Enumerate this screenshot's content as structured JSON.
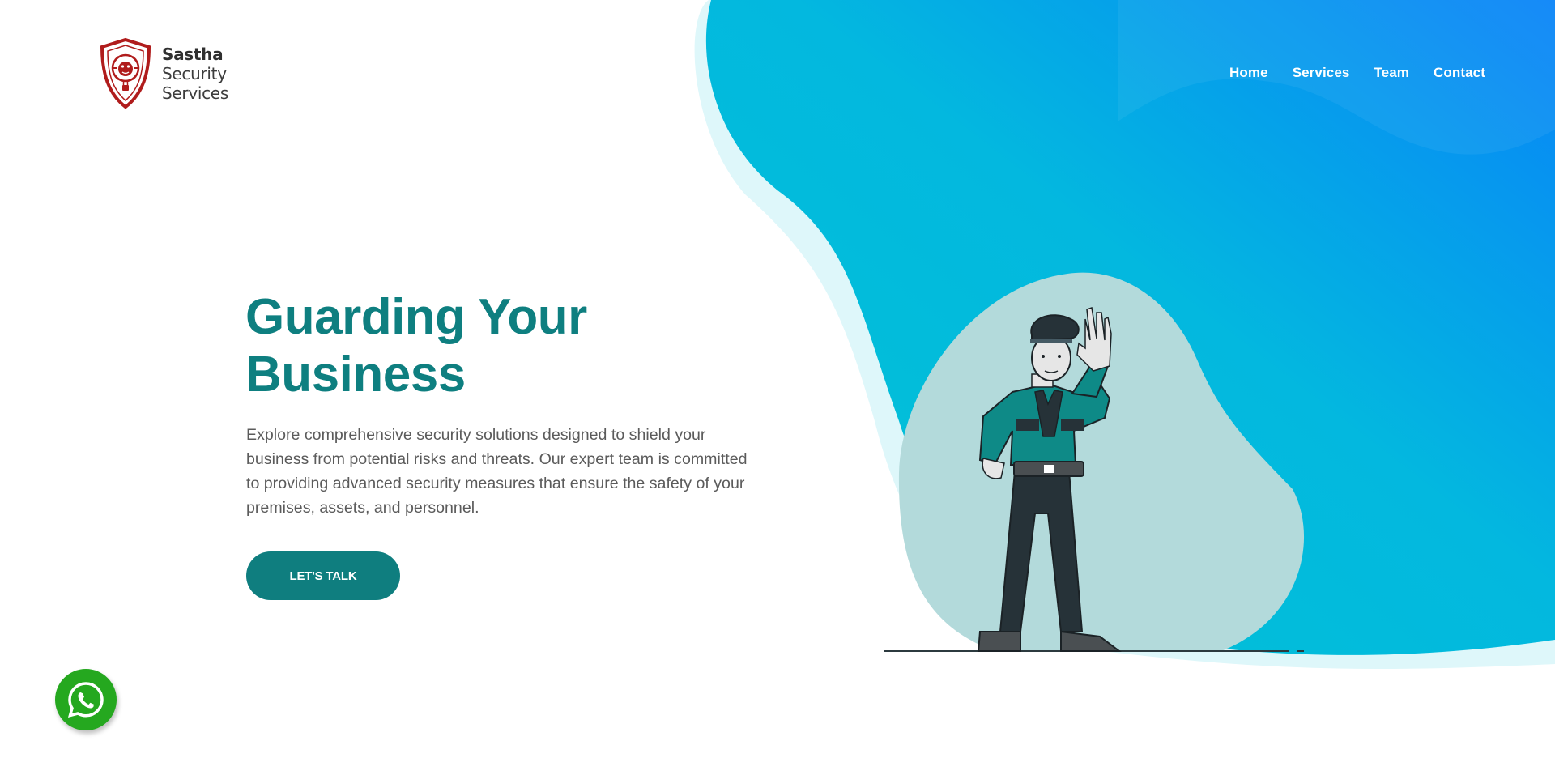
{
  "brand": {
    "name_line1": "Sastha",
    "name_line2": "Security",
    "name_line3": "Services",
    "logo_icon": "lion-shield-icon"
  },
  "nav": {
    "items": [
      {
        "label": "Home"
      },
      {
        "label": "Services"
      },
      {
        "label": "Team"
      },
      {
        "label": "Contact"
      }
    ]
  },
  "hero": {
    "title_line1": "Guarding Your",
    "title_line2": "Business",
    "description": "Explore comprehensive security solutions designed to shield your business from potential risks and threats. Our expert team is committed to providing advanced security measures that ensure the safety of your premises, assets, and personnel.",
    "cta_label": "LET'S TALK",
    "illustration_icon": "security-guard-illustration"
  },
  "floating": {
    "whatsapp_icon": "whatsapp-icon"
  },
  "colors": {
    "accent": "#0f7e7f",
    "blob_start": "#00c2d6",
    "blob_end": "#0a86f7",
    "logo_red": "#b01c1c",
    "whatsapp_green": "#25a81f"
  }
}
